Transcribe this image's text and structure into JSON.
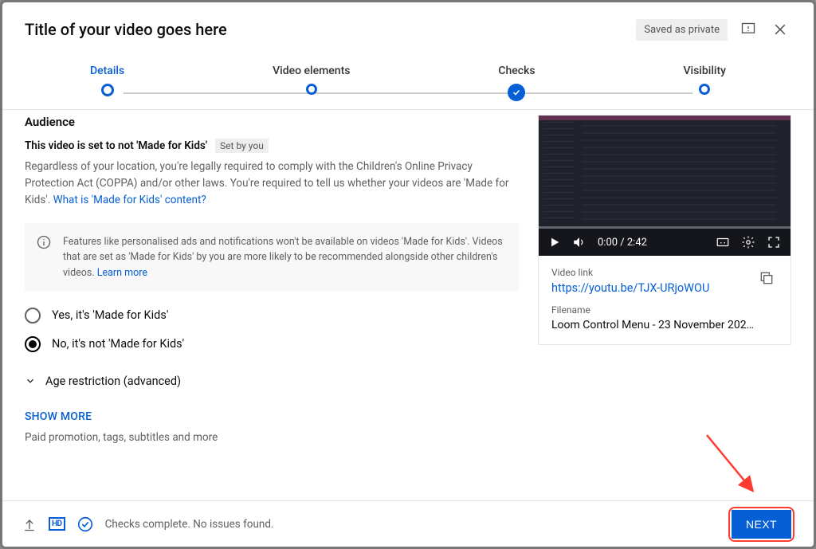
{
  "header": {
    "title": "Title of your video goes here",
    "status_badge": "Saved as private"
  },
  "stepper": {
    "steps": [
      {
        "label": "Details",
        "state": "active"
      },
      {
        "label": "Video elements",
        "state": "pending"
      },
      {
        "label": "Checks",
        "state": "done"
      },
      {
        "label": "Visibility",
        "state": "pending"
      }
    ]
  },
  "audience": {
    "heading": "Audience",
    "kids_statement": "This video is set to not 'Made for Kids'",
    "set_by_chip": "Set by you",
    "description": "Regardless of your location, you're legally required to comply with the Children's Online Privacy Protection Act (COPPA) and/or other laws. You're required to tell us whether your videos are 'Made for Kids'. ",
    "description_link": "What is 'Made for Kids' content?",
    "notice_text": "Features like personalised ads and notifications won't be available on videos 'Made for Kids'. Videos that are set as 'Made for Kids' by you are more likely to be recommended alongside other children's videos. ",
    "notice_link": "Learn more",
    "radio_yes": "Yes, it's 'Made for Kids'",
    "radio_no": "No, it's not 'Made for Kids'",
    "selected": "no",
    "age_restriction_label": "Age restriction (advanced)",
    "show_more": "SHOW MORE",
    "show_more_hint": "Paid promotion, tags, subtitles and more"
  },
  "preview": {
    "time_display": "0:00 / 2:42",
    "link_label": "Video link",
    "link_url": "https://youtu.be/TJX-URjoWOU",
    "filename_label": "Filename",
    "filename": "Loom Control Menu - 23 November 202…"
  },
  "footer": {
    "checks_text": "Checks complete. No issues found.",
    "next_label": "NEXT"
  }
}
